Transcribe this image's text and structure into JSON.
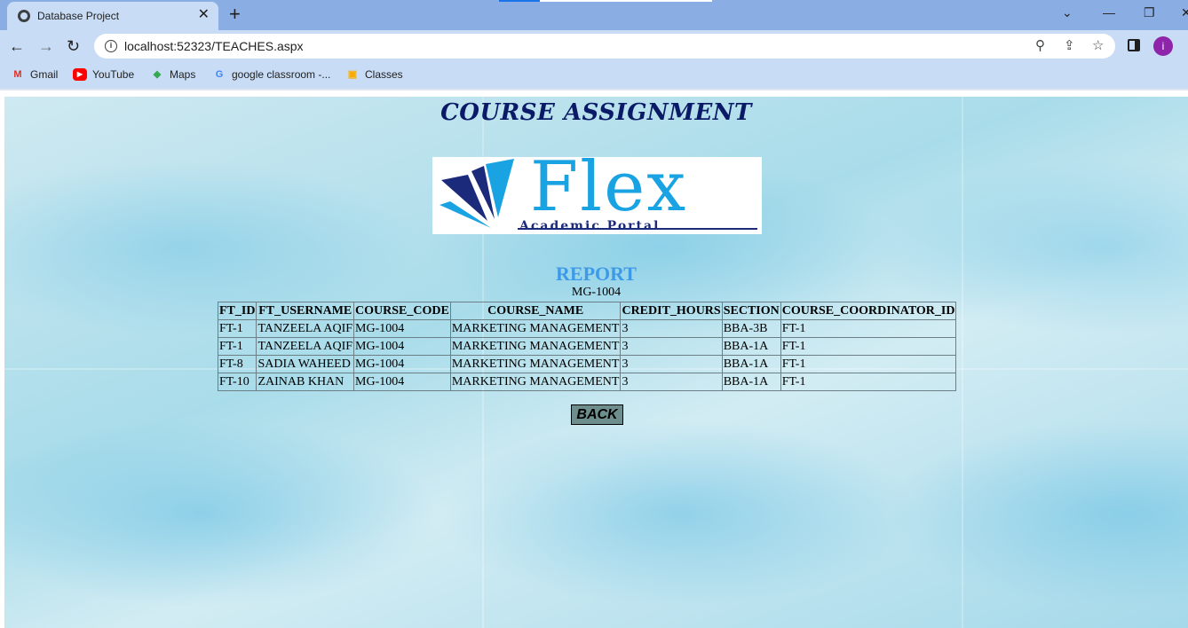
{
  "browser": {
    "tab_title": "Database Project",
    "tab_close": "✕",
    "new_tab": "+",
    "url": "localhost:52323/TEACHES.aspx",
    "nav": {
      "back": "←",
      "forward": "→",
      "reload": "↻"
    },
    "window": {
      "menu": "⌄",
      "minimize": "—",
      "restore": "❐",
      "close": "✕"
    },
    "avatar_letter": "i",
    "bookmarks": [
      {
        "label": "Gmail",
        "icon": "gmail-icon",
        "glyph": "M",
        "color": "#d93025"
      },
      {
        "label": "YouTube",
        "icon": "youtube-icon",
        "glyph": "▶",
        "color": "#ff0000"
      },
      {
        "label": "Maps",
        "icon": "maps-icon",
        "glyph": "◆",
        "color": "#34a853"
      },
      {
        "label": "google classroom -...",
        "icon": "google-icon",
        "glyph": "G",
        "color": "#4285f4"
      },
      {
        "label": "Classes",
        "icon": "classroom-icon",
        "glyph": "▣",
        "color": "#f9ab00"
      }
    ]
  },
  "page": {
    "title": "COURSE ASSIGNMENT",
    "logo": {
      "word": "Flex",
      "subtitle": "Academic Portal"
    },
    "report_title": "REPORT",
    "report_code": "MG-1004",
    "table": {
      "headers": [
        "FT_ID",
        "FT_USERNAME",
        "COURSE_CODE",
        "COURSE_NAME",
        "CREDIT_HOURS",
        "SECTION",
        "COURSE_COORDINATOR_ID"
      ],
      "rows": [
        [
          "FT-1",
          "TANZEELA AQIF",
          "MG-1004",
          "MARKETING MANAGEMENT",
          "3",
          "BBA-3B",
          "FT-1"
        ],
        [
          "FT-1",
          "TANZEELA AQIF",
          "MG-1004",
          "MARKETING MANAGEMENT",
          "3",
          "BBA-1A",
          "FT-1"
        ],
        [
          "FT-8",
          "SADIA WAHEED",
          "MG-1004",
          "MARKETING MANAGEMENT",
          "3",
          "BBA-1A",
          "FT-1"
        ],
        [
          "FT-10",
          "ZAINAB KHAN",
          "MG-1004",
          "MARKETING MANAGEMENT",
          "3",
          "BBA-1A",
          "FT-1"
        ]
      ]
    },
    "back_label": "BACK"
  },
  "colors": {
    "tab_strip": "#8aaee3",
    "toolbar": "#c9dcf5",
    "title": "#0a1a66",
    "report_title": "#3d9ae8",
    "back_button": "#6e8e8e",
    "logo_blue": "#1aa3e2",
    "logo_navy": "#1b2a7a"
  }
}
